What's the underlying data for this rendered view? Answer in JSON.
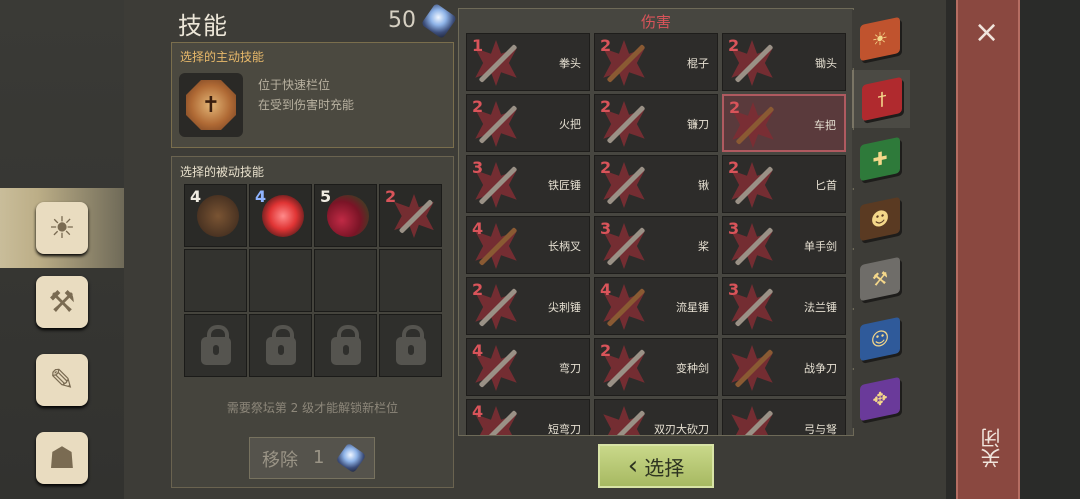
{
  "header": {
    "title": "技能",
    "points": "50"
  },
  "active_section": {
    "label": "选择的主动技能",
    "desc_line1": "位于快速栏位",
    "desc_line2": "在受到伤害时充能",
    "icon": "cross-medal-icon"
  },
  "passive_section": {
    "label": "选择的被动技能",
    "slots": [
      {
        "level": "4",
        "icon": "log-icon"
      },
      {
        "level": "4",
        "icon": "medkit-icon"
      },
      {
        "level": "5",
        "icon": "berries-icon"
      },
      {
        "level": "2",
        "icon": "spear-icon"
      }
    ],
    "note": "需要祭坛第 2 级才能解锁新栏位",
    "remove_label": "移除",
    "remove_count": "1"
  },
  "damage": {
    "title": "伤害",
    "cells": [
      {
        "level": "1",
        "name": "拳头"
      },
      {
        "level": "2",
        "name": "棍子"
      },
      {
        "level": "2",
        "name": "锄头"
      },
      {
        "level": "2",
        "name": "火把"
      },
      {
        "level": "2",
        "name": "镰刀"
      },
      {
        "level": "2",
        "name": "车把"
      },
      {
        "level": "3",
        "name": "铁匠锤"
      },
      {
        "level": "2",
        "name": "锹"
      },
      {
        "level": "2",
        "name": "匕首"
      },
      {
        "level": "4",
        "name": "长柄叉"
      },
      {
        "level": "3",
        "name": "桨"
      },
      {
        "level": "3",
        "name": "单手剑"
      },
      {
        "level": "2",
        "name": "尖刺锤"
      },
      {
        "level": "4",
        "name": "流星锤"
      },
      {
        "level": "3",
        "name": "法兰锤"
      },
      {
        "level": "4",
        "name": "弯刀"
      },
      {
        "level": "2",
        "name": "变种剑"
      },
      {
        "level": "",
        "name": "战争刀"
      },
      {
        "level": "4",
        "name": "短弯刀"
      },
      {
        "level": "",
        "name": "双刃大砍刀"
      },
      {
        "level": "",
        "name": "弓与弩"
      }
    ]
  },
  "buttons": {
    "select_label": "选择",
    "close_label": "关闭",
    "close_icon": "×"
  },
  "colors": {
    "accent_red": "#d9545a",
    "select_green": "#b5c672",
    "close_panel": "#8a4840"
  }
}
